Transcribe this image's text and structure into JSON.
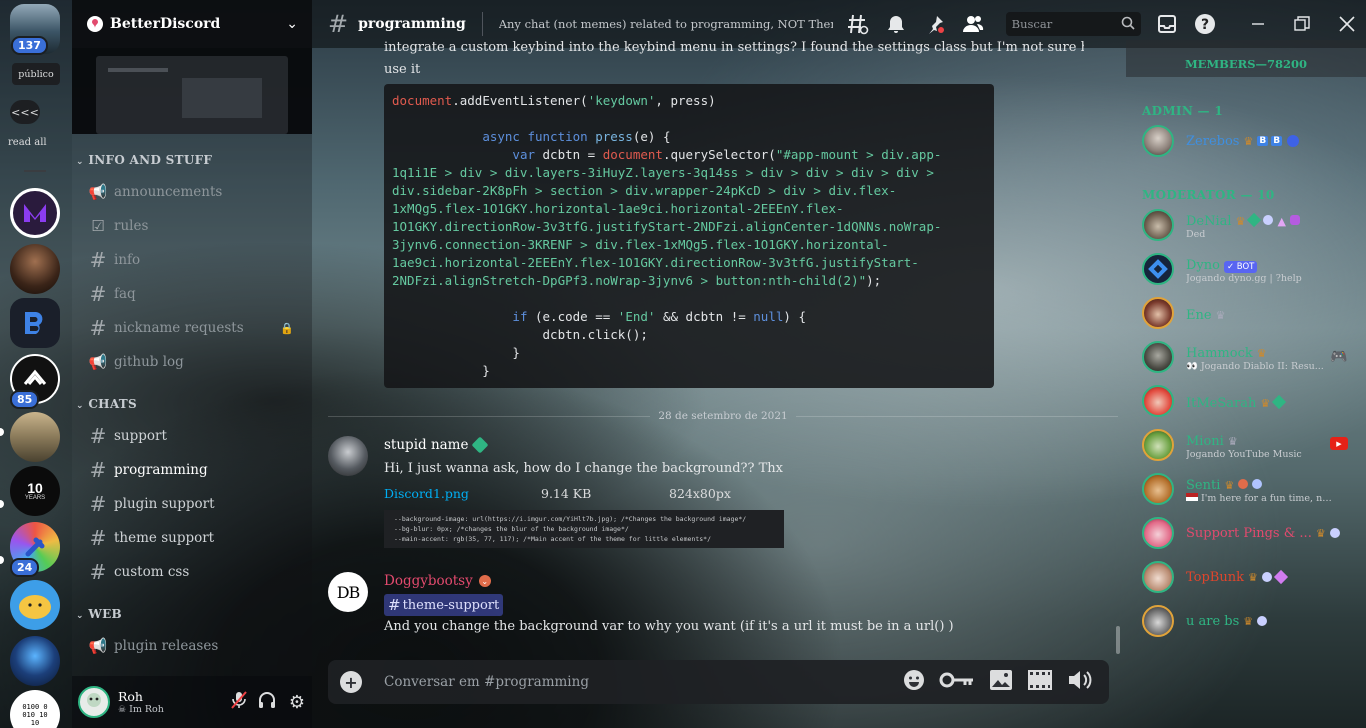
{
  "servers": {
    "top_badge": "137",
    "public_label": "público",
    "collapse_label": "<<<",
    "read_all_label": "read all",
    "badge_85": "85",
    "ten_years_num": "10",
    "ten_years_label": "YEARS",
    "badge_24": "24",
    "binary_text": "0100 0010 1010"
  },
  "guild": {
    "name": "BetterDiscord"
  },
  "categories": {
    "info": "INFO AND STUFF",
    "chats": "CHATS",
    "web": "WEB"
  },
  "channels": {
    "info": [
      {
        "name": "announcements",
        "icon": "megaphone-icon"
      },
      {
        "name": "rules",
        "icon": "checklist-icon"
      },
      {
        "name": "info",
        "icon": "hash-icon"
      },
      {
        "name": "faq",
        "icon": "hash-icon"
      },
      {
        "name": "nickname requests",
        "icon": "hash-locked-icon"
      },
      {
        "name": "github log",
        "icon": "megaphone-icon"
      }
    ],
    "chats": [
      {
        "name": "support"
      },
      {
        "name": "programming"
      },
      {
        "name": "plugin support"
      },
      {
        "name": "theme support"
      },
      {
        "name": "custom css"
      }
    ],
    "web": [
      {
        "name": "plugin releases"
      }
    ]
  },
  "user": {
    "name": "Roh",
    "status": "Im Roh"
  },
  "topbar": {
    "channel": "programming",
    "topic": "Any chat (not memes) related to programming, NOT Themes and...",
    "search_placeholder": "Buscar"
  },
  "chat": {
    "prev_text_line1": "integrate a custom keybind into the keybind menu in settings? I found the settings class but I'm not sure how to",
    "prev_text_line2": "use it",
    "date_divider": "28 de setembro de 2021",
    "msg1": {
      "author": "stupid name",
      "text": "Hi, I just wanna ask, how do I change the background?? Thx",
      "file_name": "Discord1.png",
      "file_size": "9.14 KB",
      "file_dims": "824x80px",
      "snippet": [
        "--background-image: url(https://i.imgur.com/YiHlt7b.jpg); /*Changes the background image*/",
        "--bg-blur: 0px; /*changes the blur of the background image*/",
        "--main-accent: rgb(35, 77, 117); /*Main accent of the theme for little elements*/"
      ]
    },
    "msg2": {
      "author": "Doggybootsy",
      "channel_mention": "theme-support",
      "text": "And you change the background var to why you want (if it's a url it must be in a url() )"
    },
    "composer_placeholder": "Conversar em #programming"
  },
  "members": {
    "header": "MEMBERS—78200",
    "admin_label": "ADMIN — 1",
    "mod_label": "MODERATOR — 10",
    "admin": [
      {
        "name": "Zerebos",
        "color": "#3f8fe0"
      }
    ],
    "mods": [
      {
        "name": "DeNial",
        "activity": "Ded",
        "color": "#2fb583"
      },
      {
        "name": "Dyno",
        "bot": "BOT",
        "activity": "Jogando dyno.gg | ?help",
        "color": "#2fb583"
      },
      {
        "name": "Ene",
        "activity": "",
        "color": "#2fb583"
      },
      {
        "name": "Hammock",
        "activity": "Jogando Diablo II: Resu...",
        "color": "#2fb583"
      },
      {
        "name": "ItMeSarah",
        "activity": "",
        "color": "#2fb583"
      },
      {
        "name": "Mioni",
        "activity": "Jogando YouTube Music",
        "color": "#2fb583"
      },
      {
        "name": "Senti",
        "activity": "I'm here for a fun time, not a...",
        "color": "#2fb583"
      },
      {
        "name": "Support Pings & ...",
        "activity": "",
        "color": "#e24a6e"
      },
      {
        "name": "TopBunk",
        "activity": "",
        "color": "#e0452c"
      },
      {
        "name": "u are bs",
        "activity": "",
        "color": "#2fb583"
      }
    ]
  },
  "colors": {
    "accent_green": "#2fb583",
    "mention_bg": "#5865f2",
    "link_blue": "#00aff4"
  }
}
